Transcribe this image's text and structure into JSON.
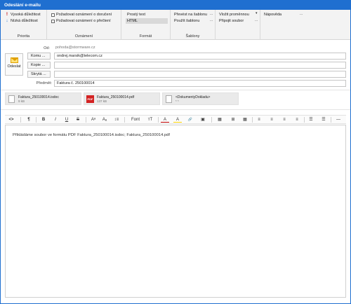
{
  "window": {
    "title": "Odeslání e-mailu"
  },
  "ribbon": {
    "priority": {
      "title": "Priorita",
      "high_label": "Vysoká důležitost",
      "low_label": "Nízká důležitost"
    },
    "notifications": {
      "title": "Oznámení",
      "delivery_label": "Požadovat oznámení o doručení",
      "read_label": "Požadovat oznámení o přečtení"
    },
    "format": {
      "title": "Formát",
      "plain_label": "Prostý text",
      "html_label": "HTML"
    },
    "templates": {
      "title": "Šablony",
      "convert_label": "Převést na šablonu",
      "use_label": "Použít šablonu",
      "dots": "..."
    },
    "insert": {
      "variable_label": "Vložit proměnnou",
      "attach_label": "Připojit soubor",
      "dots": "..."
    },
    "help": {
      "label": "Nápověda",
      "dots": "..."
    }
  },
  "header": {
    "send_label": "Odeslat",
    "from_label": "Od:",
    "from_value": "pohoda@stormware.cz",
    "to_button": "Komu ...",
    "to_value": "ondrej.marsik@telecom.cz",
    "cc_button": "Kopie ...",
    "cc_value": "",
    "bcc_button": "Skrytá ...",
    "bcc_value": "",
    "subject_label": "Předmět:",
    "subject_value": "Faktura č. 250100014"
  },
  "attachments": [
    {
      "name": "Faktura_250100014.isdoc",
      "size": "9 kB",
      "kind": "file"
    },
    {
      "name": "Faktura_250100014.pdf",
      "size": "137 kB",
      "kind": "pdf",
      "badge": "PDF"
    },
    {
      "name": "<DokumentyDokladu>",
      "size": "* *",
      "kind": "file"
    }
  ],
  "toolbar": {
    "code": "<>",
    "paragraph": "¶",
    "bold": "B",
    "italic": "I",
    "underline": "U",
    "strike": "S",
    "superscript": "Aᵃ",
    "subscript": "Aₐ",
    "line_height": "↕≡",
    "font": "Font",
    "font_size": "ᴛT",
    "font_color": "A",
    "highlight": "A",
    "link": "🔗",
    "image": "▣",
    "table": "▦",
    "table_edit": "⊞",
    "align_left": "≡",
    "align_center": "≡",
    "align_right": "≡",
    "align_justify": "≡",
    "bullets": "☰",
    "numbers": "☰",
    "hr": "—"
  },
  "editor": {
    "body_text": "Přikládáme soubor ve formátu PDF Faktura_250100014.isdoc; Faktura_250100014.pdf"
  }
}
